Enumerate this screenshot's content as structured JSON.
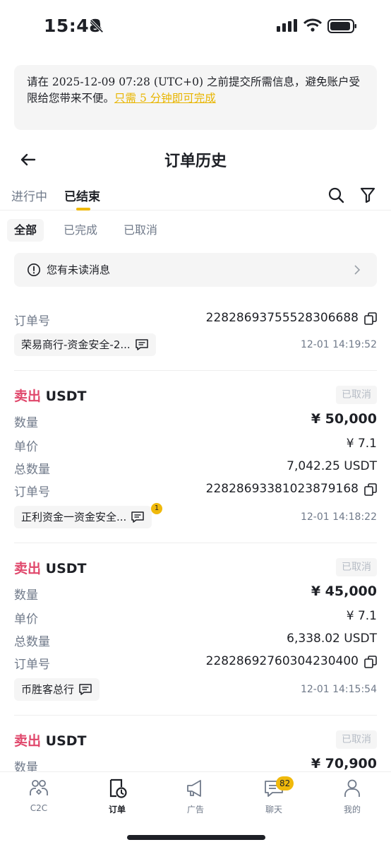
{
  "status_bar": {
    "time": "15:48"
  },
  "notice": {
    "text": "请在 2025-12-09 07:28 (UTC+0) 之前提交所需信息，避免账户受限给您带来不便。",
    "link": "只需 5 分钟即可完成"
  },
  "header": {
    "title": "订单历史"
  },
  "tabs": [
    {
      "label": "进行中"
    },
    {
      "label": "已结束"
    }
  ],
  "chips": [
    {
      "label": "全部"
    },
    {
      "label": "已完成"
    },
    {
      "label": "已取消"
    }
  ],
  "unread": {
    "text": "您有未读消息"
  },
  "labels": {
    "quantity": "数量",
    "price": "单价",
    "total": "总数量",
    "order_no": "订单号"
  },
  "orders": [
    {
      "order_no": "22828693755528306688",
      "merchant": "荣易商行-资金安全-2...",
      "time": "12-01 14:19:52"
    },
    {
      "side": "卖出",
      "asset": "USDT",
      "status": "已取消",
      "quantity": "¥ 50,000",
      "price": "¥ 7.1",
      "total": "7,042.25 USDT",
      "order_no": "22828693381023879168",
      "merchant": "正利资金一资金安全...",
      "unread": "1",
      "time": "12-01 14:18:22"
    },
    {
      "side": "卖出",
      "asset": "USDT",
      "status": "已取消",
      "quantity": "¥ 45,000",
      "price": "¥ 7.1",
      "total": "6,338.02 USDT",
      "order_no": "22828692760304230400",
      "merchant": "币胜客总行",
      "time": "12-01 14:15:54"
    },
    {
      "side": "卖出",
      "asset": "USDT",
      "status": "已取消",
      "quantity": "¥ 70,900"
    }
  ],
  "bottom_nav": [
    {
      "label": "C2C",
      "icon": "people-icon"
    },
    {
      "label": "订单",
      "icon": "order-icon"
    },
    {
      "label": "广告",
      "icon": "megaphone-icon"
    },
    {
      "label": "聊天",
      "icon": "chat-icon",
      "badge": "82"
    },
    {
      "label": "我的",
      "icon": "profile-icon"
    }
  ]
}
